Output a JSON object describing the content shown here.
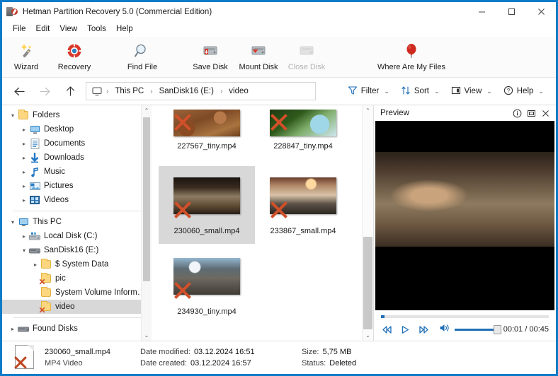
{
  "window": {
    "title": "Hetman Partition Recovery 5.0 (Commercial Edition)",
    "icon": "app-icon",
    "minimize": "─",
    "maximize": "□",
    "close": "✕",
    "accent_color": "#0a7cc8"
  },
  "menu": [
    {
      "label": "File"
    },
    {
      "label": "Edit"
    },
    {
      "label": "View"
    },
    {
      "label": "Tools"
    },
    {
      "label": "Help"
    }
  ],
  "toolbar": [
    {
      "label": "Wizard",
      "icon": "wand-icon",
      "enabled": true
    },
    {
      "label": "Recovery",
      "icon": "lifebuoy-icon",
      "enabled": true
    },
    {
      "label": "Find File",
      "icon": "magnifier-icon",
      "enabled": true
    },
    {
      "label": "Save Disk",
      "icon": "save-disk-icon",
      "enabled": true
    },
    {
      "label": "Mount Disk",
      "icon": "mount-disk-icon",
      "enabled": true
    },
    {
      "label": "Close Disk",
      "icon": "close-disk-icon",
      "enabled": false
    },
    {
      "label": "Where Are My Files",
      "icon": "balloon-icon",
      "enabled": true
    }
  ],
  "nav": {
    "back": "←",
    "forward": "→",
    "up": "↑",
    "breadcrumb": [
      {
        "label": "This PC"
      },
      {
        "label": "SanDisk16 (E:)"
      },
      {
        "label": "video"
      }
    ],
    "separator": "›",
    "tools": [
      {
        "label": "Filter",
        "icon": "funnel-icon"
      },
      {
        "label": "Sort",
        "icon": "sort-arrows-icon"
      },
      {
        "label": "View",
        "icon": "view-layout-icon"
      },
      {
        "label": "Help",
        "icon": "question-circle-icon"
      }
    ],
    "chevron": "⌄"
  },
  "sidebar": {
    "groups": [
      {
        "items": [
          {
            "label": "Folders",
            "level": 0,
            "twisty": "expanded",
            "icon": "folder-icon",
            "selected": false,
            "deleted": false
          },
          {
            "label": "Desktop",
            "level": 1,
            "twisty": "collapsed",
            "icon": "desktop-icon",
            "selected": false,
            "deleted": false
          },
          {
            "label": "Documents",
            "level": 1,
            "twisty": "collapsed",
            "icon": "documents-icon",
            "selected": false,
            "deleted": false
          },
          {
            "label": "Downloads",
            "level": 1,
            "twisty": "collapsed",
            "icon": "downloads-icon",
            "selected": false,
            "deleted": false
          },
          {
            "label": "Music",
            "level": 1,
            "twisty": "collapsed",
            "icon": "music-icon",
            "selected": false,
            "deleted": false
          },
          {
            "label": "Pictures",
            "level": 1,
            "twisty": "collapsed",
            "icon": "pictures-icon",
            "selected": false,
            "deleted": false
          },
          {
            "label": "Videos",
            "level": 1,
            "twisty": "collapsed",
            "icon": "videos-icon",
            "selected": false,
            "deleted": false
          }
        ]
      },
      {
        "items": [
          {
            "label": "This PC",
            "level": 0,
            "twisty": "expanded",
            "icon": "this-pc-icon",
            "selected": false,
            "deleted": false
          },
          {
            "label": "Local Disk (C:)",
            "level": 1,
            "twisty": "collapsed",
            "icon": "hdd-icon",
            "selected": false,
            "deleted": false
          },
          {
            "label": "SanDisk16 (E:)",
            "level": 1,
            "twisty": "expanded",
            "icon": "usb-drive-icon",
            "selected": false,
            "deleted": false
          },
          {
            "label": "$ System Data",
            "level": 2,
            "twisty": "collapsed",
            "icon": "folder-icon",
            "selected": false,
            "deleted": false
          },
          {
            "label": "pic",
            "level": 2,
            "twisty": "none",
            "icon": "folder-icon",
            "selected": false,
            "deleted": true
          },
          {
            "label": "System Volume Information",
            "level": 2,
            "twisty": "none",
            "icon": "folder-icon",
            "selected": false,
            "deleted": false
          },
          {
            "label": "video",
            "level": 2,
            "twisty": "none",
            "icon": "folder-icon",
            "selected": true,
            "deleted": true
          }
        ]
      },
      {
        "items": [
          {
            "label": "Found Disks",
            "level": 0,
            "twisty": "collapsed",
            "icon": "usb-drive-icon",
            "selected": false,
            "deleted": false
          }
        ]
      }
    ],
    "scroll_up": "⌃",
    "scroll_down": "⌄"
  },
  "files": {
    "rows": [
      [
        {
          "name": "227567_tiny.mp4",
          "art": "art1",
          "deleted": true,
          "selected": false
        },
        {
          "name": "228847_tiny.mp4",
          "art": "art2",
          "deleted": true,
          "selected": false
        }
      ],
      [
        {
          "name": "230060_small.mp4",
          "art": "art3",
          "deleted": true,
          "selected": true
        },
        {
          "name": "233867_small.mp4",
          "art": "art4",
          "deleted": true,
          "selected": false
        }
      ],
      [
        {
          "name": "234930_tiny.mp4",
          "art": "art5",
          "deleted": true,
          "selected": false
        }
      ]
    ],
    "scroll_up": "⌃",
    "scroll_down": "⌄"
  },
  "preview": {
    "title": "Preview",
    "info_icon": "info-circle-icon",
    "popout_icon": "popout-icon",
    "close_icon": "close-icon",
    "controls": {
      "rewind": "«",
      "play": "▷",
      "forward": "»",
      "volume_icon": "speaker-icon",
      "time": "00:01 / 00:45"
    }
  },
  "status": {
    "file_icon": "deleted-file-icon",
    "filename": "230060_small.mp4",
    "filetype": "MP4 Video",
    "date_modified_label": "Date modified:",
    "date_modified": "03.12.2024 16:51",
    "date_created_label": "Date created:",
    "date_created": "03.12.2024 16:57",
    "size_label": "Size:",
    "size": "5,75 MB",
    "status_label": "Status:",
    "status_value": "Deleted"
  }
}
